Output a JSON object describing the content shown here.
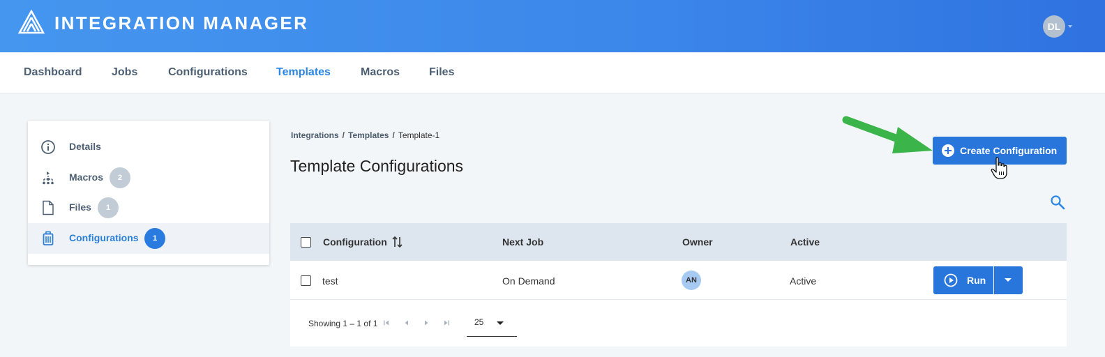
{
  "header": {
    "app_title": "INTEGRATION MANAGER",
    "user_initials": "DL"
  },
  "nav": {
    "items": [
      {
        "label": "Dashboard"
      },
      {
        "label": "Jobs"
      },
      {
        "label": "Configurations"
      },
      {
        "label": "Templates",
        "active": true
      },
      {
        "label": "Macros"
      },
      {
        "label": "Files"
      }
    ]
  },
  "sidebar": {
    "items": [
      {
        "label": "Details",
        "icon": "info-icon"
      },
      {
        "label": "Macros",
        "icon": "macro-tree-icon",
        "count": "2"
      },
      {
        "label": "Files",
        "icon": "file-icon",
        "count": "1"
      },
      {
        "label": "Configurations",
        "icon": "configuration-icon",
        "count": "1",
        "active": true
      }
    ]
  },
  "breadcrumb": {
    "items": [
      "Integrations",
      "Templates"
    ],
    "current": "Template-1",
    "separator": "/"
  },
  "page": {
    "title": "Template Configurations",
    "create_button": "Create Configuration"
  },
  "table": {
    "columns": [
      "Configuration",
      "Next Job",
      "Owner",
      "Active"
    ],
    "rows": [
      {
        "configuration": "test",
        "next_job": "On Demand",
        "owner": "AN",
        "active": "Active",
        "action": "Run"
      }
    ]
  },
  "pagination": {
    "info": "Showing 1 – 1 of 1",
    "page_size": "25"
  },
  "colors": {
    "header_gradient_start": "#4596ef",
    "header_gradient_end": "#2f72e0",
    "accent": "#2876dc",
    "annotation_arrow": "#3bb54a"
  }
}
